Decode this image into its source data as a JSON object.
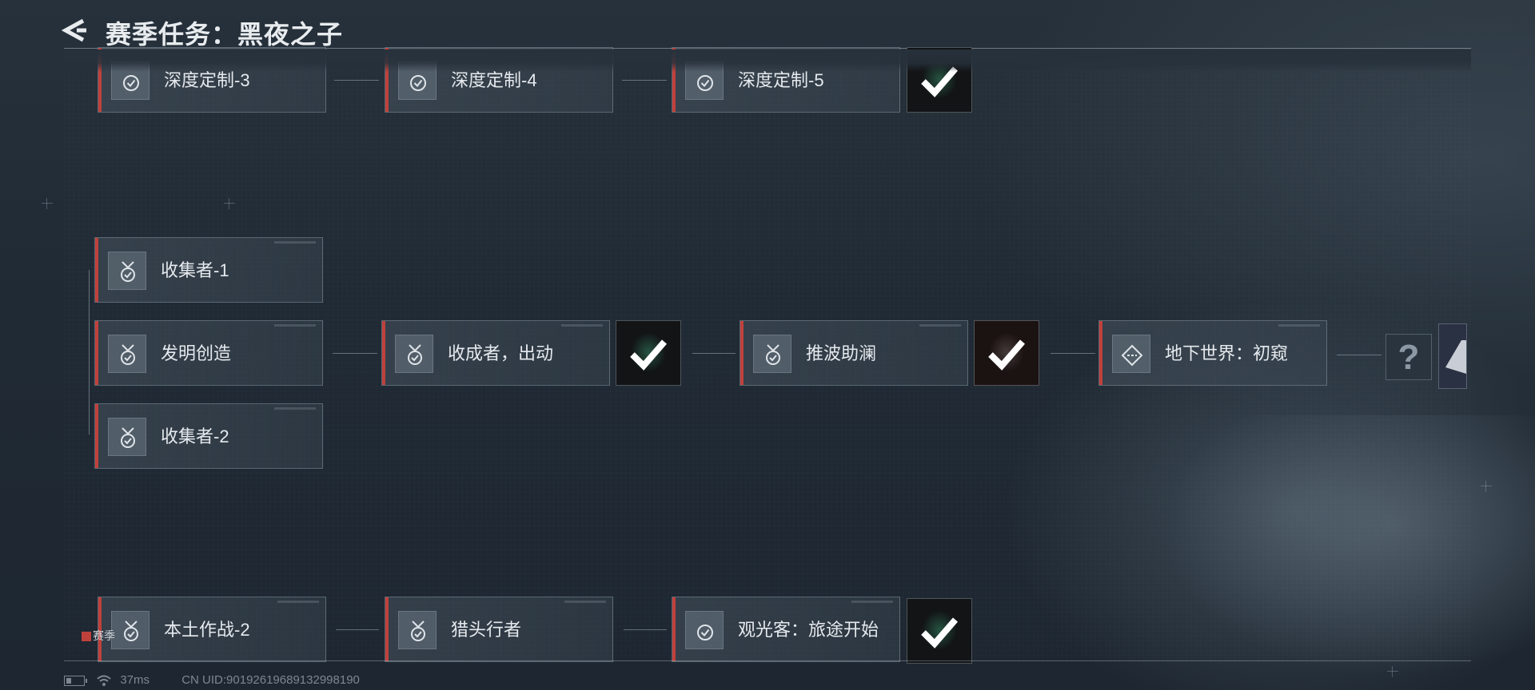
{
  "header": {
    "title": "赛季任务：黑夜之子"
  },
  "quests": {
    "row1": [
      "深度定制-3",
      "深度定制-4",
      "深度定制-5"
    ],
    "branch": [
      "收集者-1",
      "发明创造",
      "收集者-2"
    ],
    "main": [
      "收成者，出动",
      "推波助澜",
      "地下世界：初窥"
    ],
    "row3": [
      "本土作战-2",
      "猎头行者",
      "观光客：旅途开始"
    ]
  },
  "unknown_reward": "?",
  "season_tag": "赛季",
  "status": {
    "ping": "37ms",
    "uid": "CN UID:9019261968913299819​0"
  },
  "colors": {
    "accent_red": "#c0413c",
    "background": "#1e2731"
  },
  "icons": {
    "back": "back-arrow-icon",
    "medal": "medal-check-icon",
    "circle_check": "circle-check-icon",
    "diamond": "diamond-arrow-icon",
    "claimed": "claimed-check-icon"
  }
}
